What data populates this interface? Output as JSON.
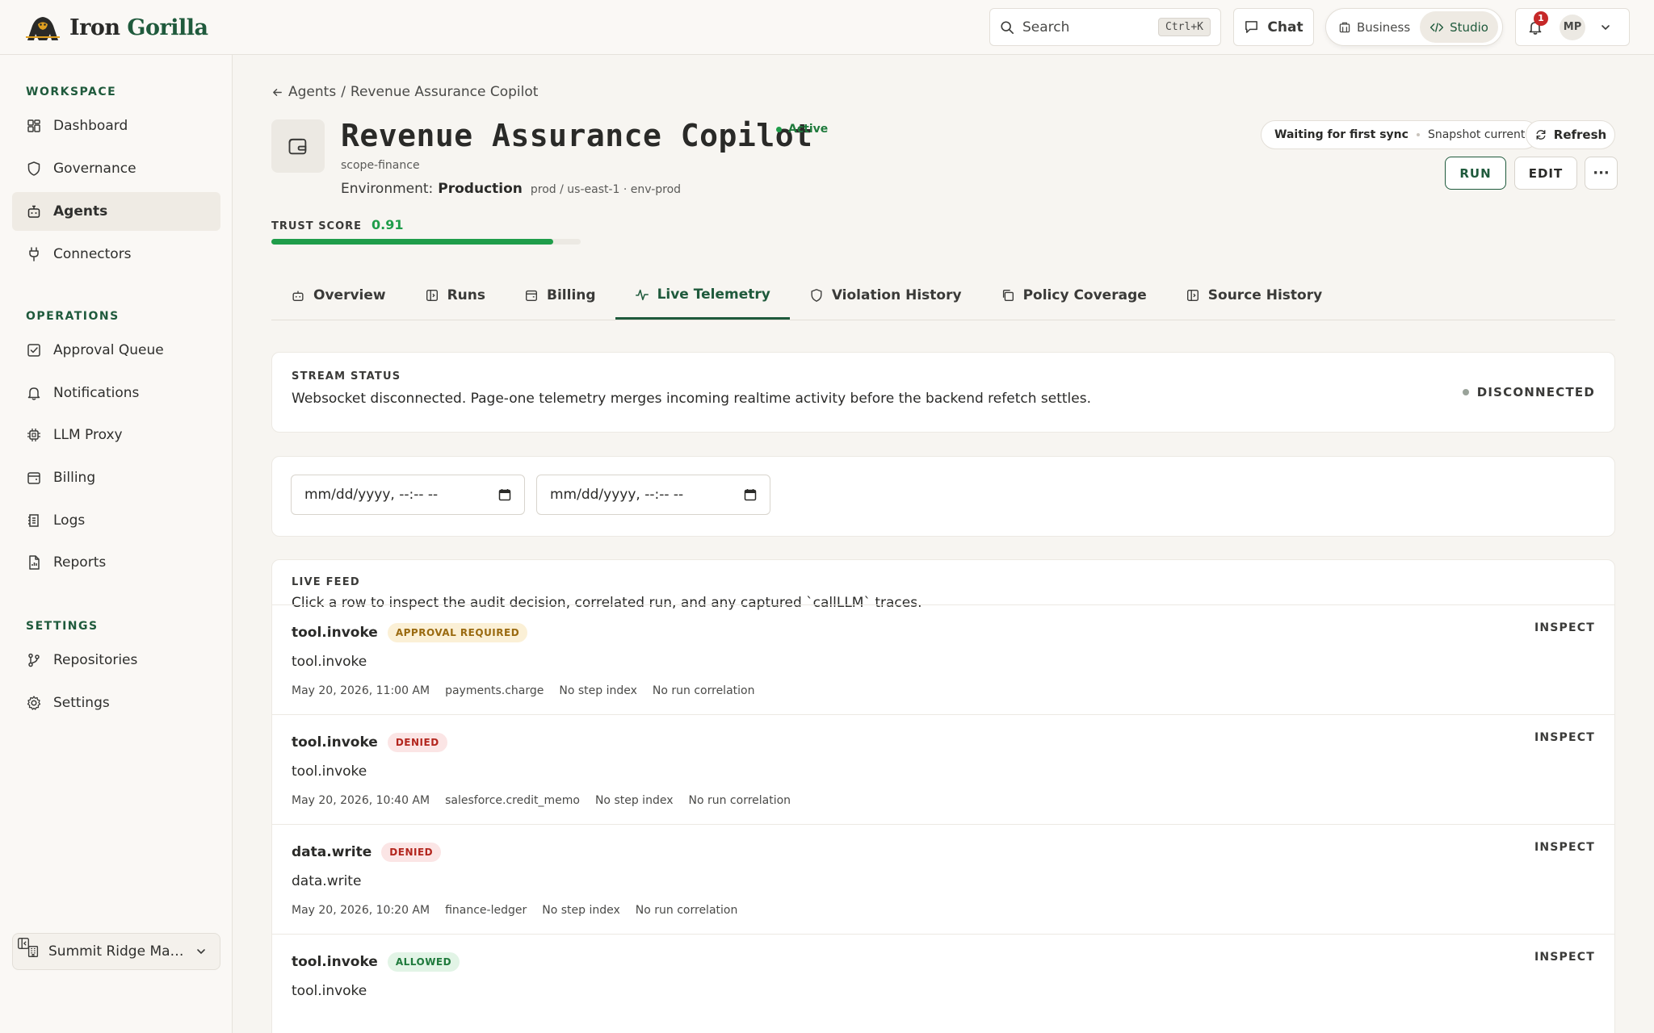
{
  "brand": {
    "name_part1": "Iron",
    "name_part2": "Gorilla"
  },
  "header": {
    "search_placeholder": "Search",
    "search_shortcut": "Ctrl+K",
    "chat_label": "Chat",
    "modes": [
      {
        "label": "Business",
        "active": false
      },
      {
        "label": "Studio",
        "active": true
      }
    ],
    "notification_count": "1",
    "user_initials": "MP"
  },
  "sidebar": {
    "sections": [
      {
        "label": "WORKSPACE",
        "items": [
          {
            "label": "Dashboard",
            "icon": "dashboard-icon"
          },
          {
            "label": "Governance",
            "icon": "shield-icon"
          },
          {
            "label": "Agents",
            "icon": "robot-icon",
            "active": true
          },
          {
            "label": "Connectors",
            "icon": "plug-icon"
          }
        ]
      },
      {
        "label": "OPERATIONS",
        "items": [
          {
            "label": "Approval Queue",
            "icon": "checkbox-icon"
          },
          {
            "label": "Notifications",
            "icon": "bell-icon"
          },
          {
            "label": "LLM Proxy",
            "icon": "chip-icon"
          },
          {
            "label": "Billing",
            "icon": "wallet-icon"
          },
          {
            "label": "Logs",
            "icon": "logs-icon"
          },
          {
            "label": "Reports",
            "icon": "report-icon"
          }
        ]
      },
      {
        "label": "SETTINGS",
        "items": [
          {
            "label": "Repositories",
            "icon": "git-branch-icon"
          },
          {
            "label": "Settings",
            "icon": "gear-icon"
          }
        ]
      }
    ],
    "org_name": "Summit Ridge Manu..."
  },
  "breadcrumb": {
    "parent": "Agents",
    "separator": "/",
    "current": "Revenue Assurance Copilot"
  },
  "agent": {
    "title": "Revenue Assurance Copilot",
    "status": "Active",
    "scope": "scope-finance",
    "env_label": "Environment:",
    "env_value": "Production",
    "env_meta": "prod / us-east-1 · env-prod",
    "trust_label": "TRUST SCORE",
    "trust_value": "0.91",
    "trust_score": 0.91
  },
  "sync": {
    "state": "Waiting for first sync",
    "snapshot": "Snapshot current"
  },
  "actions": {
    "refresh": "Refresh",
    "run": "RUN",
    "edit": "EDIT",
    "more": "···"
  },
  "tabs": [
    {
      "label": "Overview",
      "icon": "robot-icon"
    },
    {
      "label": "Runs",
      "icon": "runs-icon"
    },
    {
      "label": "Billing",
      "icon": "wallet-icon"
    },
    {
      "label": "Live Telemetry",
      "icon": "activity-icon",
      "active": true
    },
    {
      "label": "Violation History",
      "icon": "shield-icon"
    },
    {
      "label": "Policy Coverage",
      "icon": "copy-icon"
    },
    {
      "label": "Source History",
      "icon": "runs-icon"
    }
  ],
  "stream": {
    "label": "STREAM STATUS",
    "text": "Websocket disconnected. Page-one telemetry merges incoming realtime activity before the backend refetch settles.",
    "state": "DISCONNECTED"
  },
  "filters": {
    "start_placeholder": "mm/dd/yyyy, --:-- --",
    "end_placeholder": "mm/dd/yyyy, --:-- --"
  },
  "feed": {
    "label": "LIVE FEED",
    "subtitle": "Click a row to inspect the audit decision, correlated run, and any captured `callLLM` traces.",
    "inspect_label": "INSPECT",
    "rows": [
      {
        "name": "tool.invoke",
        "tag": "APPROVAL REQUIRED",
        "tag_kind": "approval",
        "sub": "tool.invoke",
        "time": "May 20, 2026, 11:00 AM",
        "resource": "payments.charge",
        "step": "No step index",
        "run": "No run correlation"
      },
      {
        "name": "tool.invoke",
        "tag": "DENIED",
        "tag_kind": "denied",
        "sub": "tool.invoke",
        "time": "May 20, 2026, 10:40 AM",
        "resource": "salesforce.credit_memo",
        "step": "No step index",
        "run": "No run correlation"
      },
      {
        "name": "data.write",
        "tag": "DENIED",
        "tag_kind": "denied",
        "sub": "data.write",
        "time": "May 20, 2026, 10:20 AM",
        "resource": "finance-ledger",
        "step": "No step index",
        "run": "No run correlation"
      },
      {
        "name": "tool.invoke",
        "tag": "ALLOWED",
        "tag_kind": "allowed",
        "sub": "tool.invoke",
        "time": "",
        "resource": "",
        "step": "",
        "run": ""
      }
    ]
  },
  "colors": {
    "brand_green": "#1f5a3c",
    "success": "#1f9d4a",
    "danger": "#b3261e",
    "warning": "#9a6a10"
  }
}
